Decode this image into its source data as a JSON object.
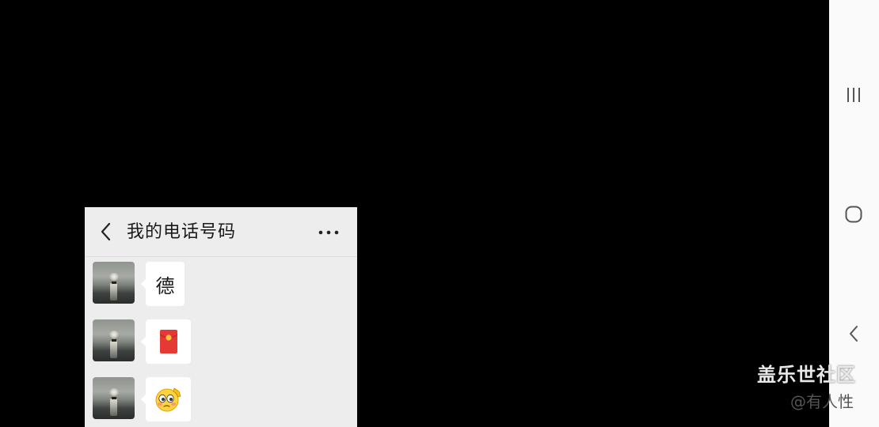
{
  "chat": {
    "title": "我的电话号码",
    "back_icon": "chevron-left-icon",
    "more_icon": "more-dots-icon",
    "messages": [
      {
        "type": "text",
        "text": "德"
      },
      {
        "type": "red-packet",
        "icon": "red-packet-icon"
      },
      {
        "type": "emoji",
        "icon": "blushing-salute-emoji"
      }
    ]
  },
  "nav": {
    "recents_icon": "recents-icon",
    "home_icon": "home-icon",
    "back_icon": "back-icon"
  },
  "watermark": {
    "title": "盖乐世社区",
    "subtitle": "@有人性"
  },
  "colors": {
    "background": "#000000",
    "chat_bg": "#ededed",
    "bubble": "#ffffff",
    "red_packet": "#e53935",
    "red_packet_seal": "#f6c340",
    "nav_bg": "#fafafa"
  }
}
